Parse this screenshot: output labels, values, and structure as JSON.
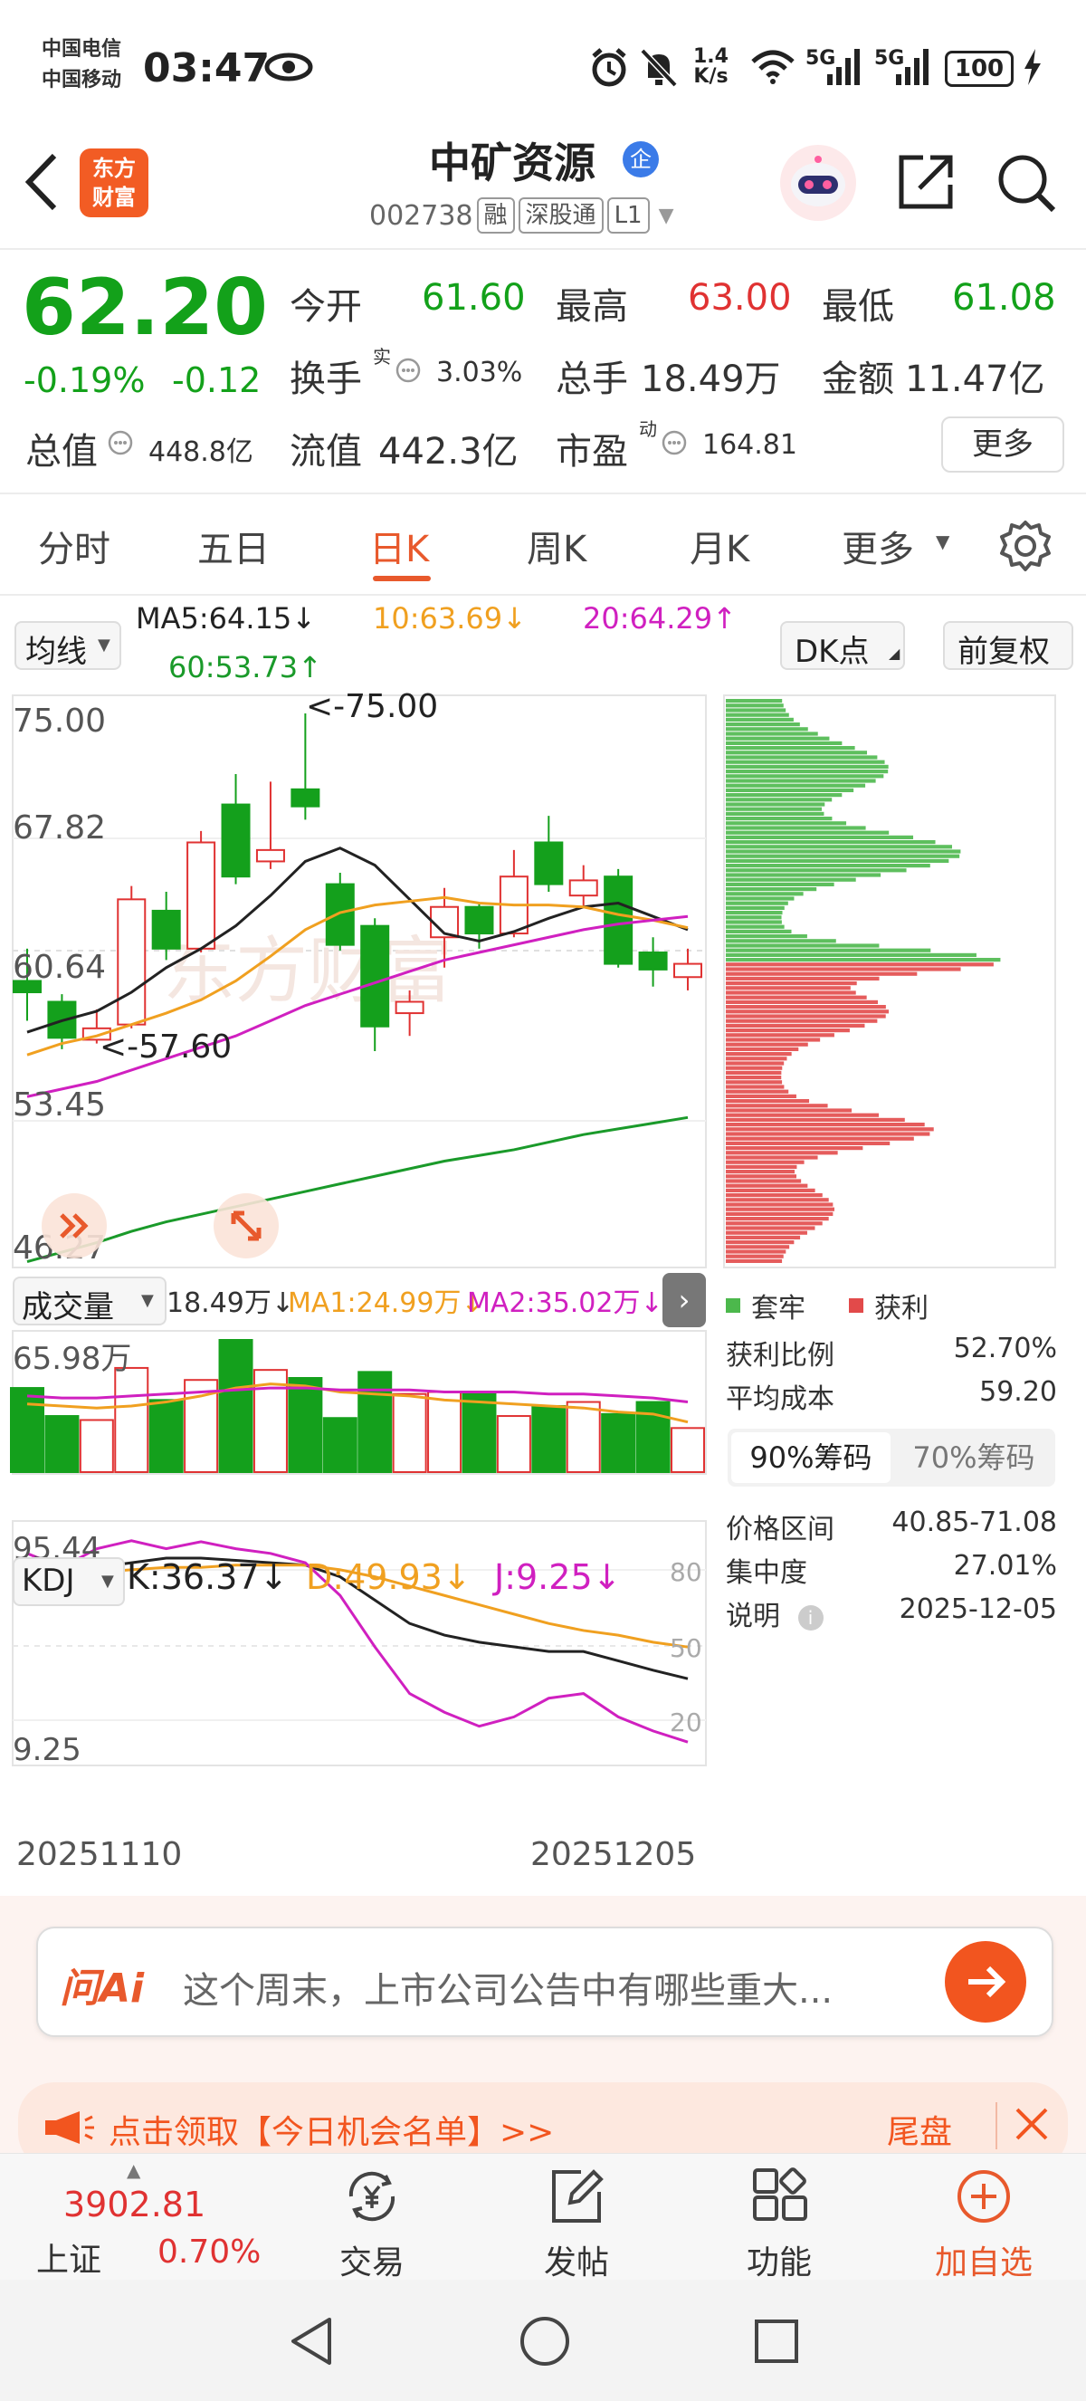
{
  "status_bar": {
    "carrier1": "中国电信",
    "carrier2": "中国移动",
    "time": "03:47",
    "net_speed_value": "1.4",
    "net_speed_unit": "K/s",
    "signal1": "5G",
    "signal2": "5G",
    "battery": "100"
  },
  "header": {
    "logo_line1": "东方",
    "logo_line2": "财富",
    "stock_name": "中矿资源",
    "badge": "企",
    "stock_code": "002738",
    "tags": [
      "融",
      "深股通",
      "L1"
    ]
  },
  "quote": {
    "price": "62.20",
    "change_pct": "-0.19%",
    "change": "-0.12",
    "open_label": "今开",
    "open": "61.60",
    "high_label": "最高",
    "high": "63.00",
    "low_label": "最低",
    "low": "61.08",
    "turnover_rate_label": "换手",
    "turnover_rate_sup": "实",
    "turnover_rate": "3.03%",
    "volume_label": "总手",
    "volume": "18.49万",
    "amount_label": "金额",
    "amount": "11.47亿",
    "total_cap_label": "总值",
    "total_cap": "448.8亿",
    "float_cap_label": "流值",
    "float_cap": "442.3亿",
    "pe_label": "市盈",
    "pe_sup": "动",
    "pe": "164.81",
    "more_button": "更多"
  },
  "tabs": [
    {
      "label": "分时"
    },
    {
      "label": "五日"
    },
    {
      "label": "日K",
      "active": true
    },
    {
      "label": "周K"
    },
    {
      "label": "月K"
    },
    {
      "label": "更多"
    }
  ],
  "ma_bar": {
    "selector": "均线",
    "ma5": "MA5:64.15↓",
    "ma10": "10:63.69↓",
    "ma20": "20:64.29↑",
    "ma60": "60:53.73↑",
    "dk_button": "DK点",
    "adjust_button": "前复权"
  },
  "kline": {
    "y_ticks": [
      "75.00",
      "67.82",
      "60.64",
      "53.45",
      "46.27"
    ],
    "max_label": "<-75.00",
    "min_label": "<-57.60",
    "watermark": "东方财富"
  },
  "volume_panel": {
    "selector": "成交量",
    "vol": "18.49万↓",
    "ma1": "MA1:24.99万↓",
    "ma2": "MA2:35.02万↓",
    "max_label": "65.98万"
  },
  "kdj_panel": {
    "selector": "KDJ",
    "k": "K:36.37↓",
    "d": "D:49.93↓",
    "j": "J:9.25↓",
    "top_label": "95.44",
    "bottom_label": "9.25",
    "levels": [
      "80",
      "50",
      "20"
    ]
  },
  "date_axis": {
    "start": "20251110",
    "end": "20251205"
  },
  "chips": {
    "legend_trapped": "套牢",
    "legend_profit": "获利",
    "rows": [
      {
        "label": "获利比例",
        "value": "52.70%"
      },
      {
        "label": "平均成本",
        "value": "59.20"
      }
    ],
    "tab90": "90%筹码",
    "tab70": "70%筹码",
    "rows2": [
      {
        "label": "价格区间",
        "value": "40.85-71.08"
      },
      {
        "label": "集中度",
        "value": "27.01%"
      },
      {
        "label": "说明",
        "value": "2025-12-05"
      }
    ]
  },
  "ai_bar": {
    "logo": "问Ai",
    "prompt": "这个周末，上市公司公告中有哪些重大..."
  },
  "promo": {
    "text": "点击领取【今日机会名单】>>",
    "tail": "尾盘"
  },
  "bottom_bar": {
    "index_value": "3902.81",
    "index_name": "上证",
    "index_change": "0.70%",
    "items": [
      "交易",
      "发帖",
      "功能",
      "加自选"
    ]
  },
  "chart_data": {
    "type": "candlestick",
    "x": [
      "20251110",
      "20251205"
    ],
    "ylim": [
      46.27,
      75.0
    ],
    "y_ticks": [
      75.0,
      67.82,
      60.64,
      53.45,
      46.27
    ],
    "candles": [
      {
        "o": 60.9,
        "c": 60.3,
        "h": 62.6,
        "l": 58.8
      },
      {
        "o": 59.8,
        "c": 57.9,
        "h": 60.2,
        "l": 57.3
      },
      {
        "o": 57.8,
        "c": 58.4,
        "h": 59.4,
        "l": 57.6
      },
      {
        "o": 58.6,
        "c": 65.2,
        "h": 65.9,
        "l": 58.4
      },
      {
        "o": 64.6,
        "c": 62.6,
        "h": 65.6,
        "l": 62.0
      },
      {
        "o": 62.6,
        "c": 68.2,
        "h": 68.8,
        "l": 62.4
      },
      {
        "o": 70.2,
        "c": 66.4,
        "h": 71.8,
        "l": 66.0
      },
      {
        "o": 67.2,
        "c": 67.8,
        "h": 71.4,
        "l": 66.8
      },
      {
        "o": 71.0,
        "c": 70.1,
        "h": 75.0,
        "l": 69.4
      },
      {
        "o": 66.0,
        "c": 62.8,
        "h": 66.6,
        "l": 62.5
      },
      {
        "o": 63.8,
        "c": 58.5,
        "h": 64.2,
        "l": 57.2
      },
      {
        "o": 59.2,
        "c": 59.8,
        "h": 60.4,
        "l": 58.0
      },
      {
        "o": 63.2,
        "c": 64.8,
        "h": 65.8,
        "l": 61.6
      },
      {
        "o": 64.8,
        "c": 63.4,
        "h": 65.0,
        "l": 62.6
      },
      {
        "o": 63.4,
        "c": 66.4,
        "h": 67.8,
        "l": 63.2
      },
      {
        "o": 68.2,
        "c": 66.0,
        "h": 69.6,
        "l": 65.6
      },
      {
        "o": 65.4,
        "c": 66.2,
        "h": 67.0,
        "l": 64.8
      },
      {
        "o": 66.4,
        "c": 61.8,
        "h": 66.8,
        "l": 61.6
      },
      {
        "o": 62.4,
        "c": 61.5,
        "h": 63.2,
        "l": 60.6
      },
      {
        "o": 61.1,
        "c": 61.8,
        "h": 62.6,
        "l": 60.4
      }
    ],
    "ma5": [
      58.2,
      58.8,
      59.3,
      60.3,
      61.6,
      62.6,
      63.8,
      65.4,
      67.2,
      67.9,
      67.0,
      65.2,
      63.4,
      63.0,
      63.5,
      64.2,
      64.8,
      65.0,
      64.3,
      63.6
    ],
    "ma10": [
      57.0,
      57.6,
      58.0,
      58.6,
      59.2,
      59.9,
      60.9,
      62.2,
      63.6,
      64.5,
      64.9,
      65.1,
      65.3,
      65.0,
      64.9,
      64.9,
      64.8,
      64.4,
      64.1,
      63.7
    ],
    "ma20": [
      54.8,
      55.2,
      55.6,
      56.2,
      56.8,
      57.4,
      58.0,
      58.8,
      59.6,
      60.2,
      60.8,
      61.4,
      62.0,
      62.4,
      62.8,
      63.2,
      63.6,
      63.9,
      64.1,
      64.3
    ],
    "ma60": [
      46.1,
      46.6,
      47.1,
      47.7,
      48.2,
      48.6,
      49.0,
      49.4,
      49.8,
      50.2,
      50.6,
      51.0,
      51.4,
      51.7,
      52.0,
      52.4,
      52.8,
      53.1,
      53.4,
      53.7
    ],
    "volume_wan": [
      42,
      28,
      26,
      52,
      36,
      46,
      65.98,
      51,
      47,
      27,
      50,
      39,
      40,
      39,
      28,
      33,
      35,
      29,
      35,
      22
    ],
    "vol_ma1": [
      34,
      33,
      32,
      33,
      35,
      38,
      42,
      44,
      43,
      40,
      39,
      38,
      36,
      35,
      34,
      33,
      32,
      30,
      29,
      25
    ],
    "vol_ma2": [
      38,
      37,
      37,
      38,
      39,
      40,
      41,
      42,
      42,
      41,
      41,
      41,
      40,
      40,
      40,
      39,
      39,
      38,
      37,
      35
    ],
    "kdj_range": [
      0,
      100
    ],
    "kdj_k": [
      86,
      85,
      84,
      86,
      88,
      88,
      87,
      86,
      85,
      80,
      70,
      60,
      55,
      52,
      50,
      48,
      48,
      44,
      40,
      36.37
    ],
    "kdj_d": [
      82,
      82,
      82,
      83,
      84,
      84,
      85,
      85,
      85,
      83,
      80,
      76,
      72,
      68,
      64,
      60,
      57,
      55,
      52,
      49.93
    ],
    "kdj_j": [
      90,
      84,
      92,
      95.44,
      92,
      95,
      92,
      90,
      86,
      72,
      50,
      30,
      22,
      16,
      20,
      28,
      30,
      20,
      14,
      9.25
    ],
    "chips_profit_color": "#e24a4a",
    "chips_trapped_color": "#4cb84c"
  }
}
